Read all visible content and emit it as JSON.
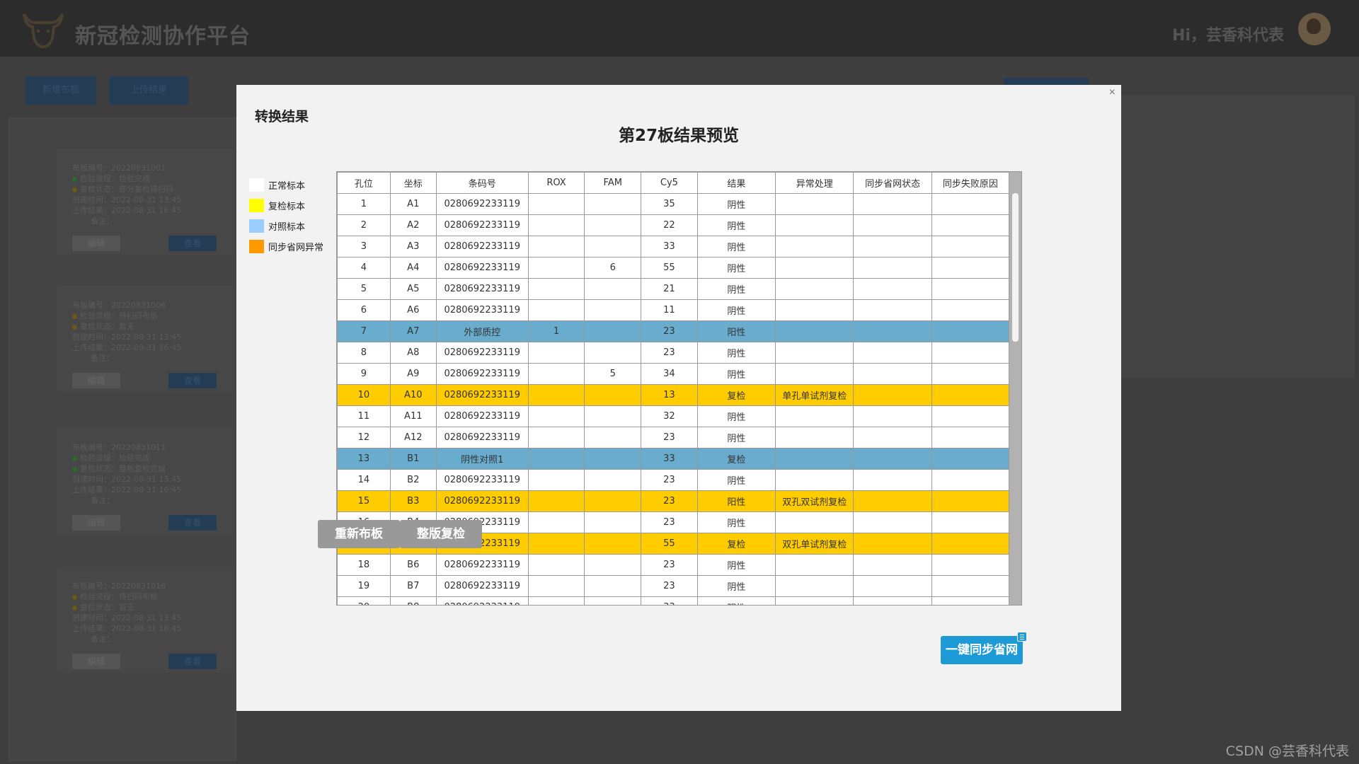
{
  "app": {
    "title": "新冠检测协作平台",
    "greeting": "Hi，芸香科代表"
  },
  "background": {
    "buttons": [
      "新增布板",
      "上传结果"
    ],
    "cards": [
      {
        "lines": [
          "布板编号：20220831001",
          "检验流程：检验完成",
          "复检状态：部分复检待扫码",
          "创建时间：2022-08-31 13:45",
          "上传结果：2022-08-31 16:45",
          "备注："
        ],
        "btn1": "编辑",
        "btn2": "查看"
      },
      {
        "lines": [
          "布板编号：20220831006",
          "检验流程：待扫码布板",
          "复检状态：暂无",
          "创建时间：2022-08-31 13:45",
          "上传结果：2022-08-31 16:45",
          "备注："
        ],
        "btn1": "编辑",
        "btn2": "查看"
      },
      {
        "lines": [
          "布板编号：20220831011",
          "检验流程：检验完成",
          "复检状态：整板复检完成",
          "创建时间：2022-08-31 13:45",
          "上传结果：2022-08-31 16:45",
          "备注："
        ],
        "btn1": "编辑",
        "btn2": "查看"
      },
      {
        "lines": [
          "布板编号：20220831016",
          "检验流程：待扫码布板",
          "复检状态：暂无",
          "创建时间：2022-08-31 13:45",
          "上传结果：2022-08-31 16:45",
          "备注："
        ],
        "btn1": "编辑",
        "btn2": "查看"
      }
    ]
  },
  "modal": {
    "close": "×",
    "title": "转换结果",
    "preview_title": "第27板结果预览",
    "legend": [
      {
        "label": "正常标本",
        "color": "#ffffff"
      },
      {
        "label": "复检标本",
        "color": "#ffff00"
      },
      {
        "label": "对照标本",
        "color": "#99ccff"
      },
      {
        "label": "同步省网异常",
        "color": "#ff9900"
      }
    ],
    "columns": [
      "孔位",
      "坐标",
      "条码号",
      "ROX",
      "FAM",
      "Cy5",
      "结果",
      "异常处理",
      "同步省网状态",
      "同步失败原因"
    ],
    "rows": [
      {
        "type": "normal",
        "cells": [
          "1",
          "A1",
          "0280692233119",
          "",
          "",
          "35",
          "阴性",
          "",
          "",
          ""
        ]
      },
      {
        "type": "normal",
        "cells": [
          "2",
          "A2",
          "0280692233119",
          "",
          "",
          "22",
          "阴性",
          "",
          "",
          ""
        ]
      },
      {
        "type": "normal",
        "cells": [
          "3",
          "A3",
          "0280692233119",
          "",
          "",
          "33",
          "阴性",
          "",
          "",
          ""
        ]
      },
      {
        "type": "normal",
        "cells": [
          "4",
          "A4",
          "0280692233119",
          "",
          "6",
          "55",
          "阴性",
          "",
          "",
          ""
        ]
      },
      {
        "type": "normal",
        "cells": [
          "5",
          "A5",
          "0280692233119",
          "",
          "",
          "21",
          "阴性",
          "",
          "",
          ""
        ]
      },
      {
        "type": "normal",
        "cells": [
          "6",
          "A6",
          "0280692233119",
          "",
          "",
          "11",
          "阴性",
          "",
          "",
          ""
        ]
      },
      {
        "type": "control",
        "cells": [
          "7",
          "A7",
          "外部质控",
          "1",
          "",
          "23",
          "阳性",
          "",
          "",
          ""
        ]
      },
      {
        "type": "normal",
        "cells": [
          "8",
          "A8",
          "0280692233119",
          "",
          "",
          "23",
          "阴性",
          "",
          "",
          ""
        ]
      },
      {
        "type": "normal",
        "cells": [
          "9",
          "A9",
          "0280692233119",
          "",
          "5",
          "34",
          "阴性",
          "",
          "",
          ""
        ]
      },
      {
        "type": "recheck",
        "cells": [
          "10",
          "A10",
          "0280692233119",
          "",
          "",
          "13",
          "复检",
          "单孔单试剂复检",
          "",
          ""
        ]
      },
      {
        "type": "normal",
        "cells": [
          "11",
          "A11",
          "0280692233119",
          "",
          "",
          "32",
          "阴性",
          "",
          "",
          ""
        ]
      },
      {
        "type": "normal",
        "cells": [
          "12",
          "A12",
          "0280692233119",
          "",
          "",
          "23",
          "阴性",
          "",
          "",
          ""
        ]
      },
      {
        "type": "control",
        "cells": [
          "13",
          "B1",
          "阴性对照1",
          "",
          "",
          "33",
          "复检",
          "",
          "",
          ""
        ]
      },
      {
        "type": "normal",
        "cells": [
          "14",
          "B2",
          "0280692233119",
          "",
          "",
          "23",
          "阴性",
          "",
          "",
          ""
        ]
      },
      {
        "type": "recheck",
        "cells": [
          "15",
          "B3",
          "0280692233119",
          "",
          "",
          "23",
          "阳性",
          "双孔双试剂复检",
          "",
          ""
        ]
      },
      {
        "type": "normal",
        "cells": [
          "16",
          "B4",
          "0280692233119",
          "",
          "",
          "23",
          "阴性",
          "",
          "",
          ""
        ]
      },
      {
        "type": "recheck",
        "cells": [
          "17",
          "B5",
          "0280692233119",
          "",
          "",
          "55",
          "复检",
          "双孔单试剂复检",
          "",
          ""
        ]
      },
      {
        "type": "normal",
        "cells": [
          "18",
          "B6",
          "0280692233119",
          "",
          "",
          "23",
          "阴性",
          "",
          "",
          ""
        ]
      },
      {
        "type": "normal",
        "cells": [
          "19",
          "B7",
          "0280692233119",
          "",
          "",
          "23",
          "阴性",
          "",
          "",
          ""
        ]
      },
      {
        "type": "normal",
        "cells": [
          "20",
          "B8",
          "0280692233119",
          "",
          "",
          "33",
          "阴性",
          "",
          "",
          ""
        ]
      }
    ],
    "buttons": {
      "rearrange": "重新布板",
      "full_recheck": "整版复检",
      "sync": "一键同步省网"
    }
  },
  "watermark": "CSDN @芸香科代表"
}
